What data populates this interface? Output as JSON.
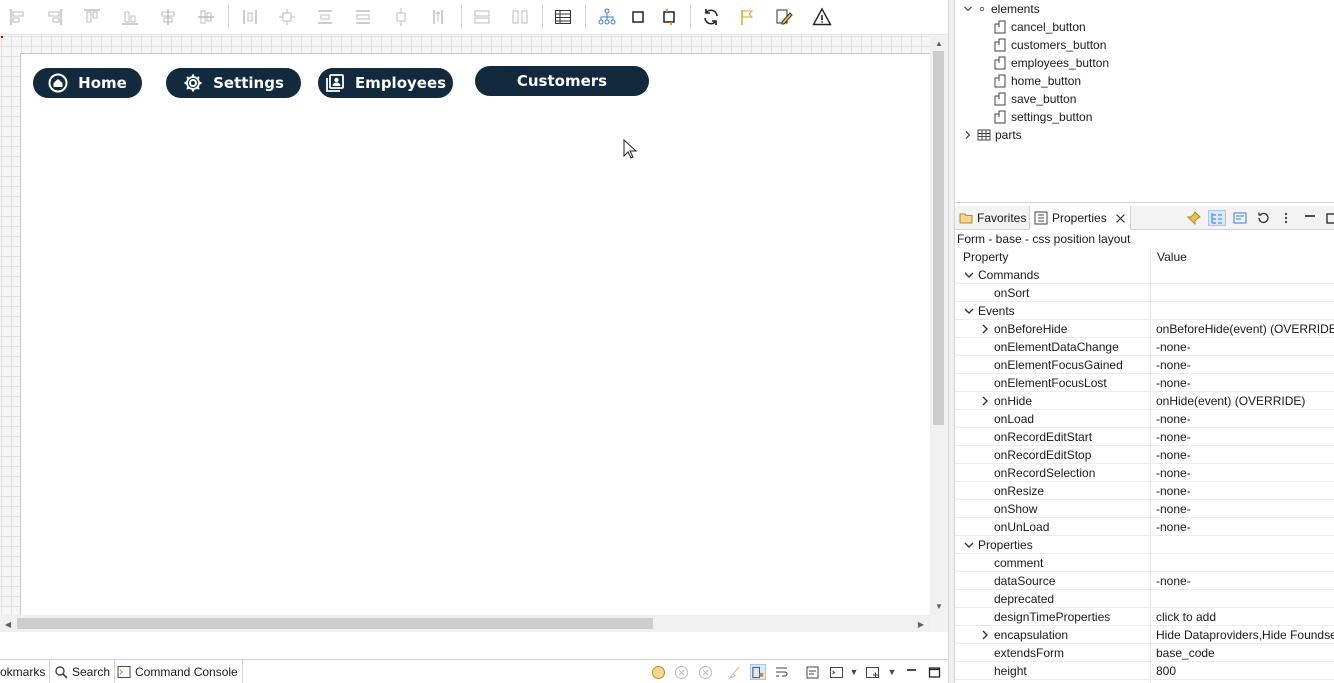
{
  "form_buttons": [
    {
      "label": "Home",
      "icon": "home-icon"
    },
    {
      "label": "Settings",
      "icon": "gear-icon"
    },
    {
      "label": "Employees",
      "icon": "contacts-icon"
    },
    {
      "label": "Customers",
      "icon": ""
    }
  ],
  "bottom_tabs": [
    {
      "label": "okmarks",
      "icon": ""
    },
    {
      "label": "Search",
      "icon": "search-icon"
    },
    {
      "label": "Command Console",
      "icon": "console-icon"
    }
  ],
  "outline": {
    "group": "elements",
    "items": [
      "cancel_button",
      "customers_button",
      "employees_button",
      "home_button",
      "save_button",
      "settings_button"
    ],
    "parts": "parts"
  },
  "props_tabs": {
    "favorites": "Favorites",
    "properties": "Properties"
  },
  "props_title": "Form - base - css position layout",
  "props_header": {
    "property": "Property",
    "value": "Value"
  },
  "props_rows": [
    {
      "name": "Commands",
      "value": "",
      "level": 0,
      "expander": "open"
    },
    {
      "name": "onSort",
      "value": "",
      "level": 1,
      "expander": ""
    },
    {
      "name": "Events",
      "value": "",
      "level": 0,
      "expander": "open"
    },
    {
      "name": "onBeforeHide",
      "value": "onBeforeHide(event) (OVERRIDE)",
      "level": 1,
      "expander": "closed"
    },
    {
      "name": "onElementDataChange",
      "value": "-none-",
      "level": 1,
      "expander": ""
    },
    {
      "name": "onElementFocusGained",
      "value": "-none-",
      "level": 1,
      "expander": ""
    },
    {
      "name": "onElementFocusLost",
      "value": "-none-",
      "level": 1,
      "expander": ""
    },
    {
      "name": "onHide",
      "value": "onHide(event) (OVERRIDE)",
      "level": 1,
      "expander": "closed"
    },
    {
      "name": "onLoad",
      "value": "-none-",
      "level": 1,
      "expander": ""
    },
    {
      "name": "onRecordEditStart",
      "value": "-none-",
      "level": 1,
      "expander": ""
    },
    {
      "name": "onRecordEditStop",
      "value": "-none-",
      "level": 1,
      "expander": ""
    },
    {
      "name": "onRecordSelection",
      "value": "-none-",
      "level": 1,
      "expander": ""
    },
    {
      "name": "onResize",
      "value": "-none-",
      "level": 1,
      "expander": ""
    },
    {
      "name": "onShow",
      "value": "-none-",
      "level": 1,
      "expander": ""
    },
    {
      "name": "onUnLoad",
      "value": "-none-",
      "level": 1,
      "expander": ""
    },
    {
      "name": "Properties",
      "value": "",
      "level": 0,
      "expander": "open"
    },
    {
      "name": "comment",
      "value": "",
      "level": 1,
      "expander": ""
    },
    {
      "name": "dataSource",
      "value": "-none-",
      "level": 1,
      "expander": ""
    },
    {
      "name": "deprecated",
      "value": "",
      "level": 1,
      "expander": ""
    },
    {
      "name": "designTimeProperties",
      "value": "click to add",
      "level": 1,
      "expander": ""
    },
    {
      "name": "encapsulation",
      "value": "Hide Dataproviders,Hide Foundse",
      "level": 1,
      "expander": "closed"
    },
    {
      "name": "extendsForm",
      "value": "base_code",
      "level": 1,
      "expander": ""
    },
    {
      "name": "height",
      "value": "800",
      "level": 1,
      "expander": ""
    }
  ],
  "colors": {
    "button_bg": "#13293d",
    "button_fg": "#ffffff",
    "selection": "#d9e8fb"
  }
}
